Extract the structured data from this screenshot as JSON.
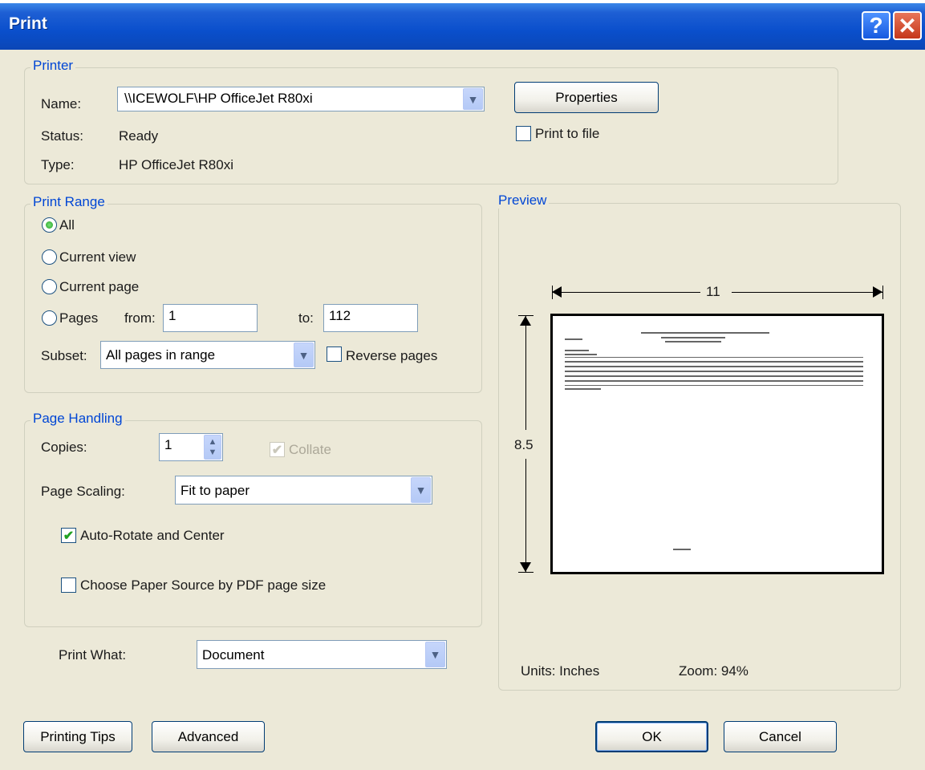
{
  "window": {
    "title": "Print"
  },
  "printer": {
    "legend": "Printer",
    "name_label": "Name:",
    "name_value": "\\\\ICEWOLF\\HP OfficeJet R80xi",
    "status_label": "Status:",
    "status_value": "Ready",
    "type_label": "Type:",
    "type_value": "HP OfficeJet R80xi",
    "properties_button": "Properties",
    "print_to_file": {
      "label": "Print to file",
      "checked": false
    }
  },
  "print_range": {
    "legend": "Print Range",
    "options": [
      "All",
      "Current view",
      "Current page",
      "Pages"
    ],
    "selected": "All",
    "from_label": "from:",
    "from_value": "1",
    "to_label": "to:",
    "to_value": "112",
    "subset_label": "Subset:",
    "subset_value": "All pages in range",
    "reverse_pages": {
      "label": "Reverse pages",
      "checked": false
    }
  },
  "page_handling": {
    "legend": "Page Handling",
    "copies_label": "Copies:",
    "copies_value": "1",
    "collate": {
      "label": "Collate",
      "checked": true,
      "enabled": false
    },
    "scaling_label": "Page Scaling:",
    "scaling_value": "Fit to paper",
    "auto_rotate": {
      "label": "Auto-Rotate and Center",
      "checked": true
    },
    "paper_source": {
      "label": "Choose Paper Source by PDF page size",
      "checked": false
    }
  },
  "print_what": {
    "label": "Print What:",
    "value": "Document"
  },
  "preview": {
    "legend": "Preview",
    "width_dim": "11",
    "height_dim": "8.5",
    "units": "Units: Inches",
    "zoom": "Zoom: 94%"
  },
  "footer": {
    "printing_tips": "Printing Tips",
    "advanced": "Advanced",
    "ok": "OK",
    "cancel": "Cancel"
  },
  "colors": {
    "titlebar": "#0a4fcc",
    "dialog_bg": "#ece9d8",
    "legend_text": "#0046d5",
    "check_green": "#21a121"
  }
}
